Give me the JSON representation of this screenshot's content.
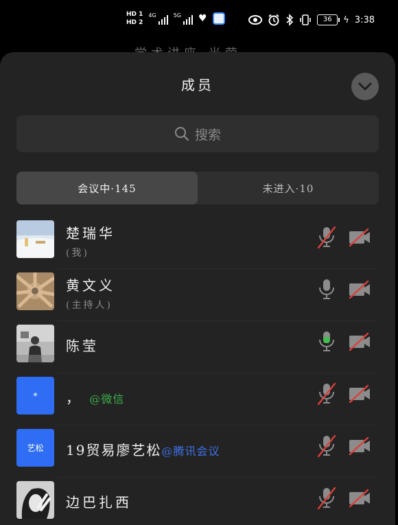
{
  "status_bar": {
    "hd1": "HD 1",
    "hd2": "HD 2",
    "net1": "4G",
    "net2": "5G",
    "battery": "36",
    "time": "3:38"
  },
  "background_title": "学术讲座 光荣",
  "panel": {
    "title": "成员",
    "search_placeholder": "搜索",
    "tabs": [
      {
        "label": "会议中·145",
        "active": true
      },
      {
        "label": "未进入·10",
        "active": false
      }
    ]
  },
  "members": [
    {
      "name": "楚瑞华",
      "subtitle": "(我)",
      "mic": "muted",
      "camera": "off",
      "avatar": "photo-snow"
    },
    {
      "name": "黄文义",
      "subtitle": "(主持人)",
      "mic": "on",
      "camera": "off",
      "avatar": "photo-hands"
    },
    {
      "name": "陈莹",
      "subtitle": "",
      "mic": "speaking",
      "camera": "off",
      "avatar": "photo-person"
    },
    {
      "name": "，",
      "tag": "@微信",
      "tag_color": "#3fae4b",
      "avatar_text": "*",
      "mic": "muted",
      "camera": "off",
      "avatar": "blue"
    },
    {
      "name": "19贸易廖艺松",
      "tag": "@腾讯会议",
      "tag_color": "#3d72ea",
      "avatar_text": "艺松",
      "mic": "muted",
      "camera": "off",
      "avatar": "blue"
    },
    {
      "name": "边巴扎西",
      "subtitle": "",
      "mic": "muted",
      "camera": "off",
      "avatar": "photo-bw"
    }
  ],
  "colors": {
    "sheet_bg": "#232323",
    "muted_red": "#d9413b",
    "speaking_green": "#3fc04f",
    "avatar_blue": "#2f6ef4"
  }
}
